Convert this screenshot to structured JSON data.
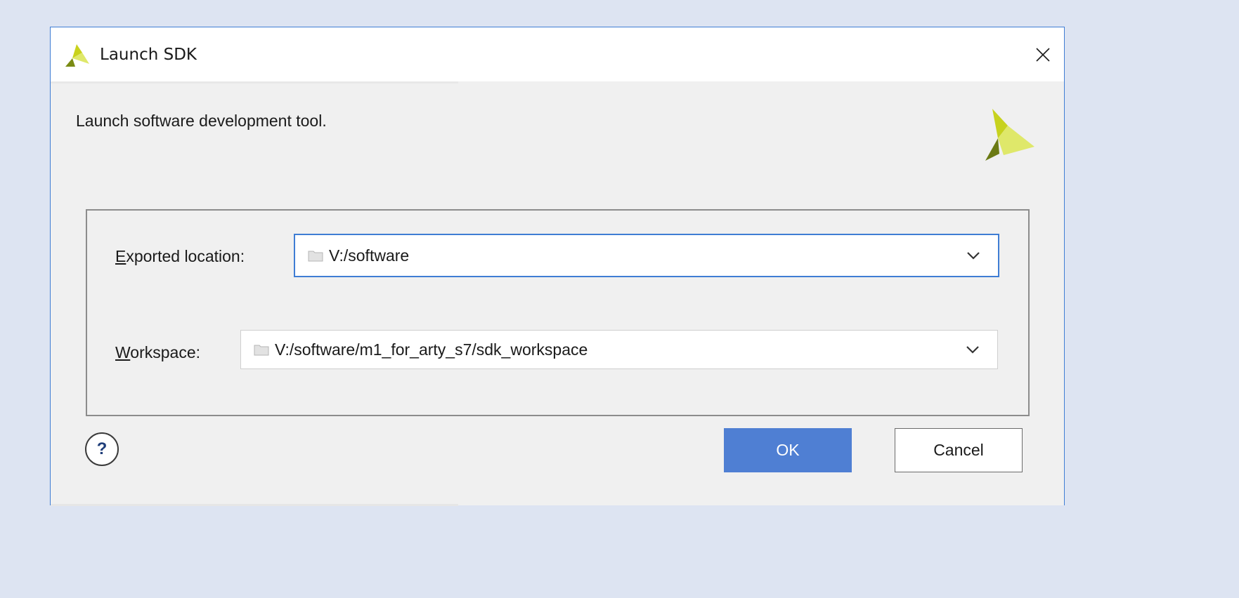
{
  "dialog": {
    "title": "Launch SDK",
    "description": "Launch software development tool.",
    "fields": {
      "exported_location": {
        "label_mnemonic": "E",
        "label_rest": "xported location:",
        "value": "V:/software"
      },
      "workspace": {
        "label_mnemonic": "W",
        "label_rest": "orkspace:",
        "value": "V:/software/m1_for_arty_s7/sdk_workspace"
      }
    },
    "help_label": "?",
    "ok_label": "OK",
    "cancel_label": "Cancel"
  },
  "icons": {
    "title": "xilinx-logo-icon",
    "close": "close-icon",
    "brand": "xilinx-logo-icon",
    "folder": "folder-icon",
    "dropdown": "chevron-down-icon",
    "help": "help-icon"
  },
  "colors": {
    "backdrop": "#dde4f2",
    "dialog_bg": "#f0f0f0",
    "focus_border": "#3f7dd4",
    "primary_button": "#4f7fd3",
    "logo_dark": "#6b7a14",
    "logo_light": "#d7e356"
  }
}
